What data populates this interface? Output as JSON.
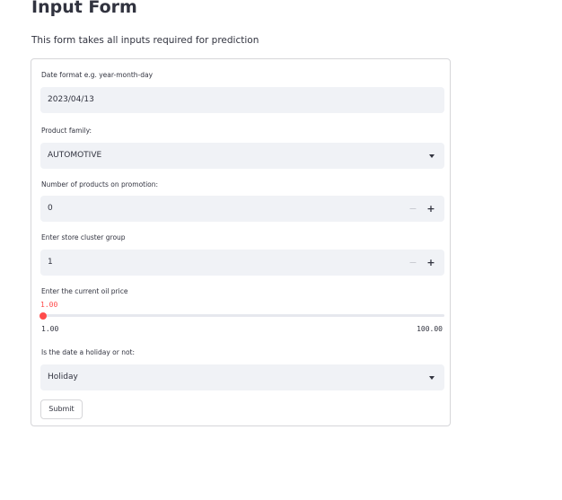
{
  "header": {
    "title": "Input Form",
    "description": "This form takes all inputs required for prediction"
  },
  "form": {
    "date": {
      "label": "Date format e.g. year-month-day",
      "value": "2023/04/13"
    },
    "family": {
      "label": "Product family:",
      "value": "AUTOMOTIVE"
    },
    "promotion": {
      "label": "Number of products on promotion:",
      "value": "0",
      "minus": "−",
      "plus": "+"
    },
    "cluster": {
      "label": "Enter store cluster group",
      "value": "1",
      "minus": "−",
      "plus": "+"
    },
    "oil": {
      "label": "Enter the current oil price",
      "value": "1.00",
      "min": "1.00",
      "max": "100.00",
      "fraction": 0
    },
    "holiday": {
      "label": "Is the date a holiday or not:",
      "value": "Holiday"
    },
    "submit_label": "Submit"
  }
}
